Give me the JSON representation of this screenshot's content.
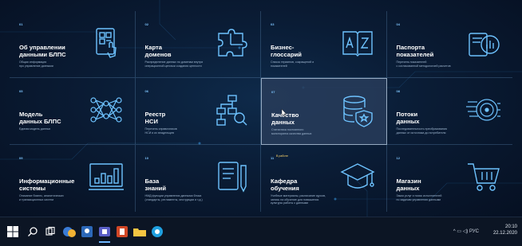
{
  "tiles": [
    {
      "num": "01",
      "title": "Об управлении\nданными БЛПС",
      "desc": "Общая информация\nпро управление данными",
      "icon": "tablet-touch-icon"
    },
    {
      "num": "02",
      "title": "Карта\nдоменов",
      "desc": "Распределение данных по доменам внутри\nоперационной цепочки создания ценности",
      "icon": "puzzle-icon"
    },
    {
      "num": "03",
      "title": "Бизнес-\nглоссарий",
      "desc": "Список терминов, сокращений и\nпоказателей",
      "icon": "dictionary-az-icon"
    },
    {
      "num": "04",
      "title": "Паспорта\nпоказателей",
      "desc": "Перечень показателей\nс согласованной методологией расчетов",
      "icon": "report-chart-icon"
    },
    {
      "num": "05",
      "title": "Модель\nданных БЛПС",
      "desc": "Единая модель данных",
      "icon": "neural-network-icon"
    },
    {
      "num": "06",
      "title": "Реестр\nНСИ",
      "desc": "Перечень справочников\nНСИ и их владельцев",
      "icon": "hierarchy-search-icon"
    },
    {
      "num": "07",
      "title": "Качество\nданных",
      "desc": "Статистика постоянного\nмониторинга качества данных",
      "icon": "database-shield-icon"
    },
    {
      "num": "08",
      "title": "Потоки\nданных",
      "desc": "Последовательность преобразования\nданных от источника до потребителя",
      "icon": "data-flow-icon"
    },
    {
      "num": "09",
      "title": "Информационные\nсистемы",
      "desc": "Описание бизнес, аналитических\nи транзакционных систем",
      "icon": "monitor-chart-icon"
    },
    {
      "num": "10",
      "title": "База\nзнаний",
      "desc": "НМД функции управления данными блока\n(стандарты, регламенты, инструкции и т.д.)",
      "icon": "knowledge-book-icon"
    },
    {
      "num": "11",
      "badge": "В работе",
      "title": "Кафедра\nобучения",
      "desc": "Учебные материалы, расписание курсов,\nзапись на обучение для повышения\nкультуры работы с данными",
      "icon": "graduation-cap-icon"
    },
    {
      "num": "12",
      "title": "Магазин\nданных",
      "desc": "Заказ услуг и поиск исполнителей\nпо задачам управления данными",
      "icon": "shopping-cart-icon"
    }
  ],
  "taskbar": {
    "tray_lang": "РУС",
    "time": "20:10",
    "date": "22.12.2020"
  },
  "colors": {
    "accent": "#7fc6ff",
    "icon_stroke": "#6ec3ff",
    "background": "#0a1c35"
  }
}
